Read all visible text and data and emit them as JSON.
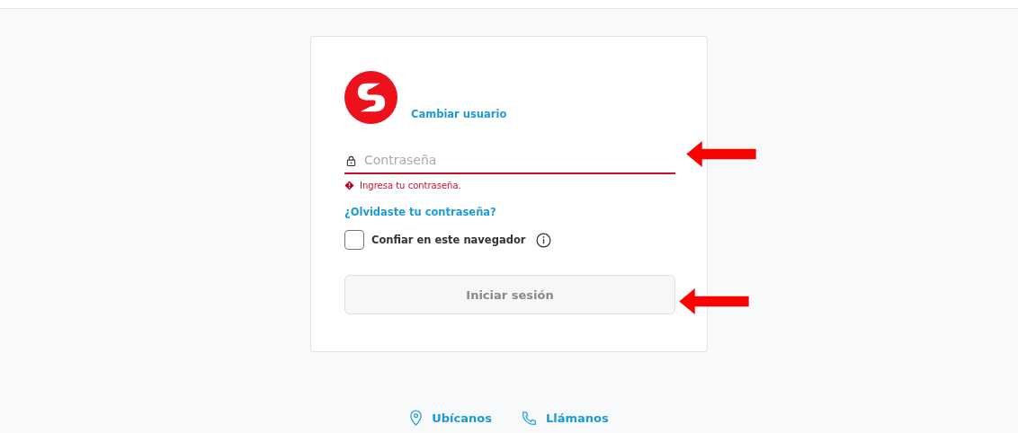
{
  "login_card": {
    "change_user_link": "Cambiar usuario",
    "password_field": {
      "placeholder": "Contraseña",
      "error": true,
      "error_message": "Ingresa tu contraseña."
    },
    "forgot_password_link": "¿Olvidaste tu contraseña?",
    "trust_browser": {
      "label": "Confiar en este navegador",
      "checked": false
    },
    "submit_button": {
      "label": "Iniciar sesión",
      "disabled": true
    }
  },
  "footer_links": [
    {
      "kind": "location",
      "label": "Ubícanos"
    },
    {
      "kind": "phone",
      "label": "Llámanos"
    }
  ]
}
